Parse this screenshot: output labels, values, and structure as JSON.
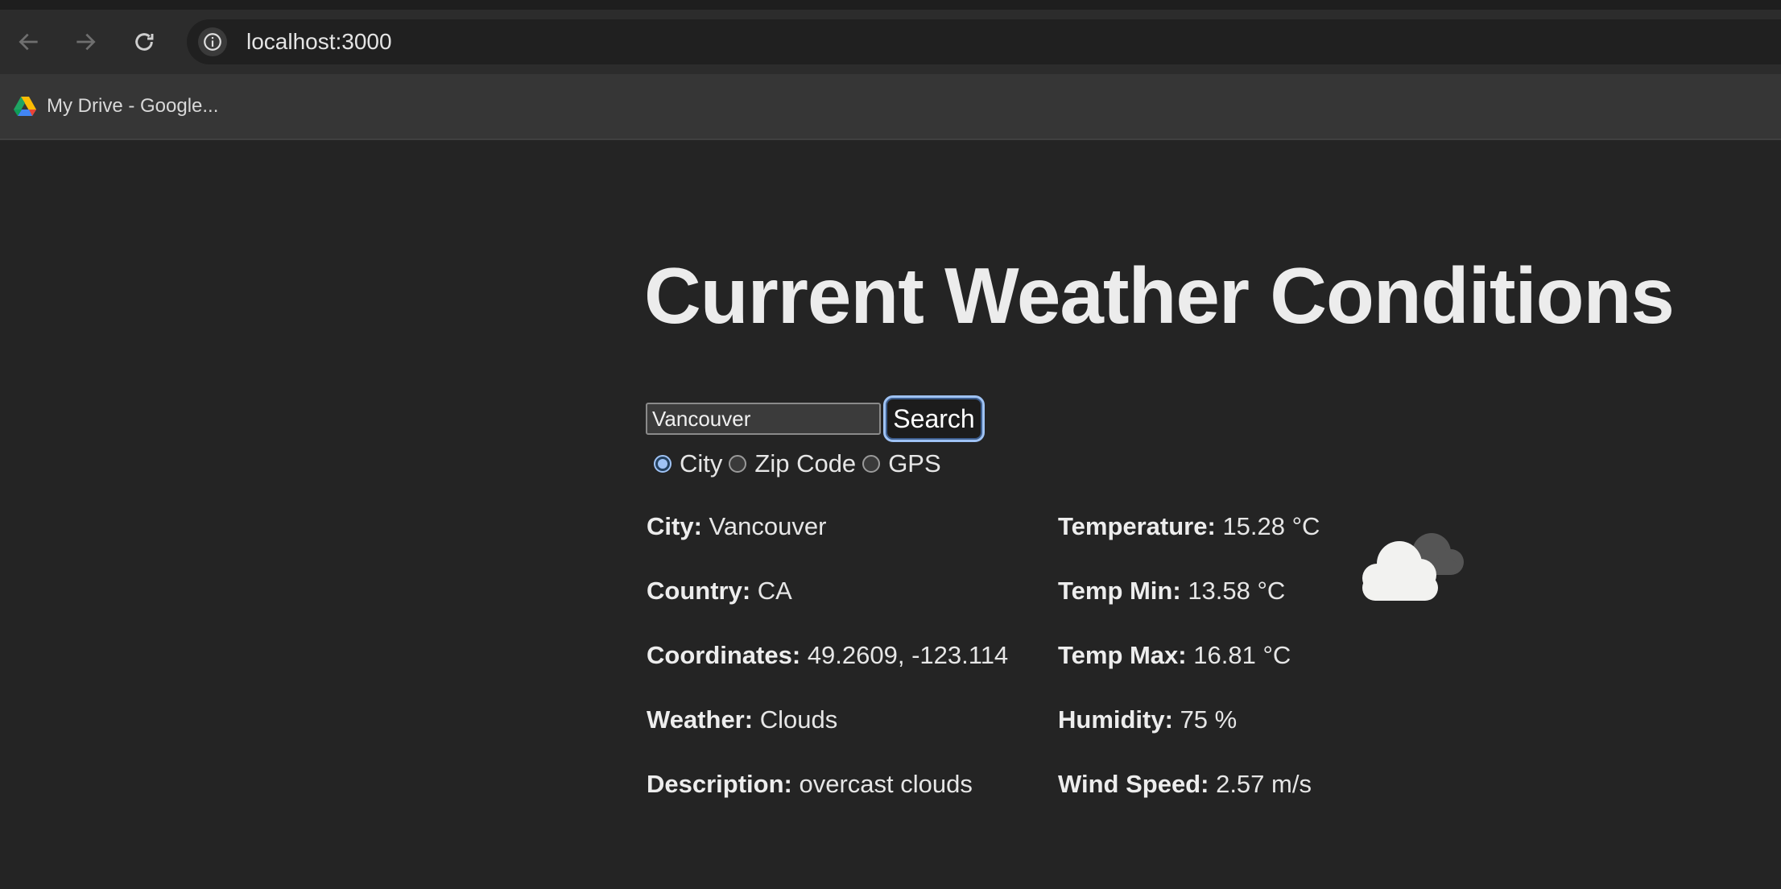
{
  "browser": {
    "url": "localhost:3000",
    "bookmark_label": "My Drive - Google...",
    "icons": {
      "back": "arrow-left-icon",
      "forward": "arrow-right-icon",
      "reload": "reload-icon",
      "info": "info-icon",
      "bookmark": "google-drive-icon"
    }
  },
  "page": {
    "title": "Current Weather Conditions",
    "search": {
      "value": "Vancouver",
      "button_label": "Search"
    },
    "search_modes": [
      {
        "label": "City",
        "checked": true
      },
      {
        "label": "Zip Code",
        "checked": false
      },
      {
        "label": "GPS",
        "checked": false
      }
    ],
    "details_left": [
      {
        "label": "City:",
        "value": "Vancouver"
      },
      {
        "label": "Country:",
        "value": "CA"
      },
      {
        "label": "Coordinates:",
        "value": "49.2609, -123.114"
      },
      {
        "label": "Weather:",
        "value": "Clouds"
      },
      {
        "label": "Description:",
        "value": "overcast clouds"
      }
    ],
    "details_right": [
      {
        "label": "Temperature:",
        "value": "15.28 °C"
      },
      {
        "label": "Temp Min:",
        "value": "13.58 °C"
      },
      {
        "label": "Temp Max:",
        "value": "16.81 °C"
      },
      {
        "label": "Humidity:",
        "value": "75 %"
      },
      {
        "label": "Wind Speed:",
        "value": "2.57 m/s"
      }
    ],
    "weather_icon": "overcast-clouds-icon"
  },
  "colors": {
    "background": "#242424",
    "accent": "#9fc3f5"
  }
}
